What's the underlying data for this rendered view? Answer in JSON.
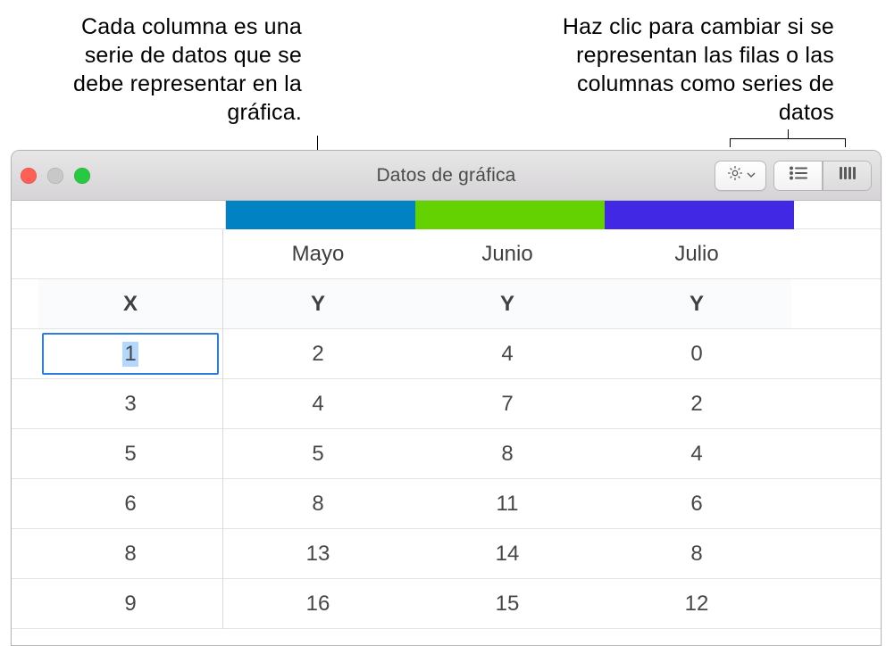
{
  "callouts": {
    "left": "Cada columna es una serie de datos que se debe representar en la gráfica.",
    "right": "Haz clic para cambiar si se representan las filas o las columnas como series de datos"
  },
  "window": {
    "title": "Datos de gráfica"
  },
  "toolbar": {
    "gear_icon": "gear-icon",
    "rows_mode_icon": "rows-icon",
    "cols_mode_icon": "columns-icon"
  },
  "series": [
    {
      "label": "Mayo",
      "color": "#0082c3"
    },
    {
      "label": "Junio",
      "color": "#64d200"
    },
    {
      "label": "Julio",
      "color": "#4028e4"
    }
  ],
  "axis_headers": {
    "x": "X",
    "y": "Y"
  },
  "rows": [
    {
      "x": "1",
      "y": [
        "2",
        "4",
        "0"
      ],
      "selected": true
    },
    {
      "x": "3",
      "y": [
        "4",
        "7",
        "2"
      ]
    },
    {
      "x": "5",
      "y": [
        "5",
        "8",
        "4"
      ]
    },
    {
      "x": "6",
      "y": [
        "8",
        "11",
        "6"
      ]
    },
    {
      "x": "8",
      "y": [
        "13",
        "14",
        "8"
      ]
    },
    {
      "x": "9",
      "y": [
        "16",
        "15",
        "12"
      ]
    }
  ],
  "chart_data": {
    "type": "table",
    "title": "Datos de gráfica",
    "x_header": "X",
    "y_header": "Y",
    "series": [
      {
        "name": "Mayo",
        "color": "#0082c3",
        "x": [
          1,
          3,
          5,
          6,
          8,
          9
        ],
        "y": [
          2,
          4,
          5,
          8,
          13,
          16
        ]
      },
      {
        "name": "Junio",
        "color": "#64d200",
        "x": [
          1,
          3,
          5,
          6,
          8,
          9
        ],
        "y": [
          4,
          7,
          8,
          11,
          14,
          15
        ]
      },
      {
        "name": "Julio",
        "color": "#4028e4",
        "x": [
          1,
          3,
          5,
          6,
          8,
          9
        ],
        "y": [
          0,
          2,
          4,
          6,
          8,
          12
        ]
      }
    ]
  }
}
